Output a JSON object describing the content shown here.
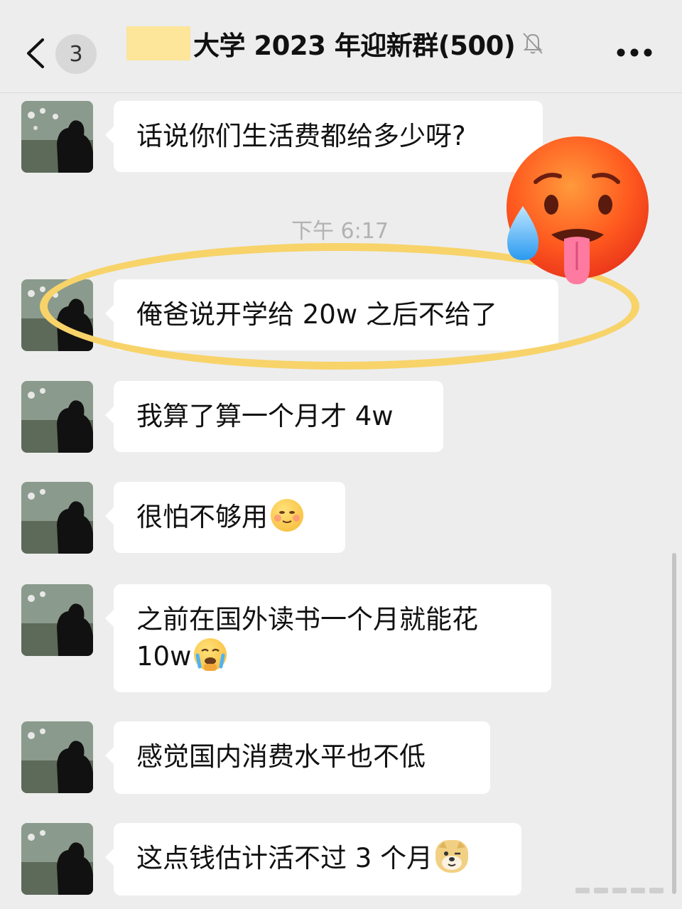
{
  "header": {
    "unread_count": "3",
    "title": "大学 2023 年迎新群(500)",
    "back_icon": "chevron-left-icon",
    "mute_icon": "bell-off-icon",
    "more_icon": "ellipsis-icon"
  },
  "messages": [
    {
      "text": "话说你们生活费都给多少呀?"
    },
    {
      "text": "俺爸说开学给 20w 之后不给了"
    },
    {
      "text": "我算了算一个月才 4w"
    },
    {
      "text": "很怕不够用",
      "emoji": "blushing-smile-icon"
    },
    {
      "text_line1": "之前在国外读书一个月就能花",
      "text_line2": "10w",
      "emoji": "crying-face-icon"
    },
    {
      "text": "感觉国内消费水平也不低"
    },
    {
      "text": "这点钱估计活不过 3 个月",
      "emoji": "doge-icon"
    }
  ],
  "timestamp": "下午 6:17",
  "overlay": {
    "emoji": "hot-face-sweat-icon",
    "highlight_color": "#f7d36a"
  },
  "colors": {
    "background": "#ededed",
    "bubble": "#ffffff",
    "timestamp": "#b2b2b2"
  }
}
